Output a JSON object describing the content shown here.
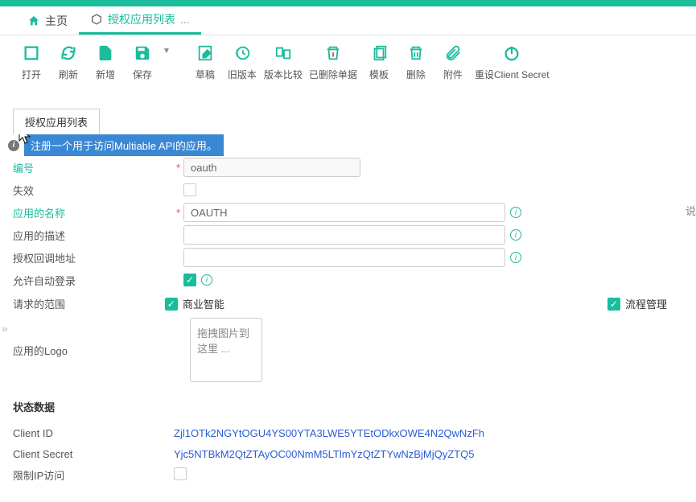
{
  "tabs": {
    "home": "主页",
    "current": "授权应用列表",
    "dots": "..."
  },
  "toolbar": {
    "open": "打开",
    "refresh": "刷新",
    "new": "新增",
    "save": "保存",
    "draft": "草稿",
    "oldver": "旧版本",
    "compare": "版本比较",
    "deleted": "已删除单据",
    "template": "模板",
    "delete": "删除",
    "attach": "附件",
    "reset": "重设Client Secret"
  },
  "subtab": "授权应用列表",
  "info_text": "注册一个用于访问Multiable API的应用。",
  "labels": {
    "code": "编号",
    "disabled": "失效",
    "appname": "应用的名称",
    "appdesc": "应用的描述",
    "callback": "授权回调地址",
    "autologin": "允许自动登录",
    "scope": "请求的范围",
    "logo": "应用的Logo"
  },
  "fields": {
    "code_value": "oauth",
    "appname_value": "OAUTH",
    "appdesc_value": "",
    "callback_value": ""
  },
  "scopes": {
    "bi": "商业智能",
    "flow": "流程管理"
  },
  "logo_placeholder": "拖拽图片到这里 ...",
  "status_section": "状态数据",
  "status": {
    "client_id_label": "Client ID",
    "client_id_value": "Zjl1OTk2NGYtOGU4YS00YTA3LWE5YTEtODkxOWE4N2QwNzFh",
    "client_secret_label": "Client Secret",
    "client_secret_value": "Yjc5NTBkM2QtZTAyOC00NmM5LTlmYzQtZTYwNzBjMjQyZTQ5",
    "restrict_ip_label": "限制IP访问"
  },
  "right_cut": "说"
}
